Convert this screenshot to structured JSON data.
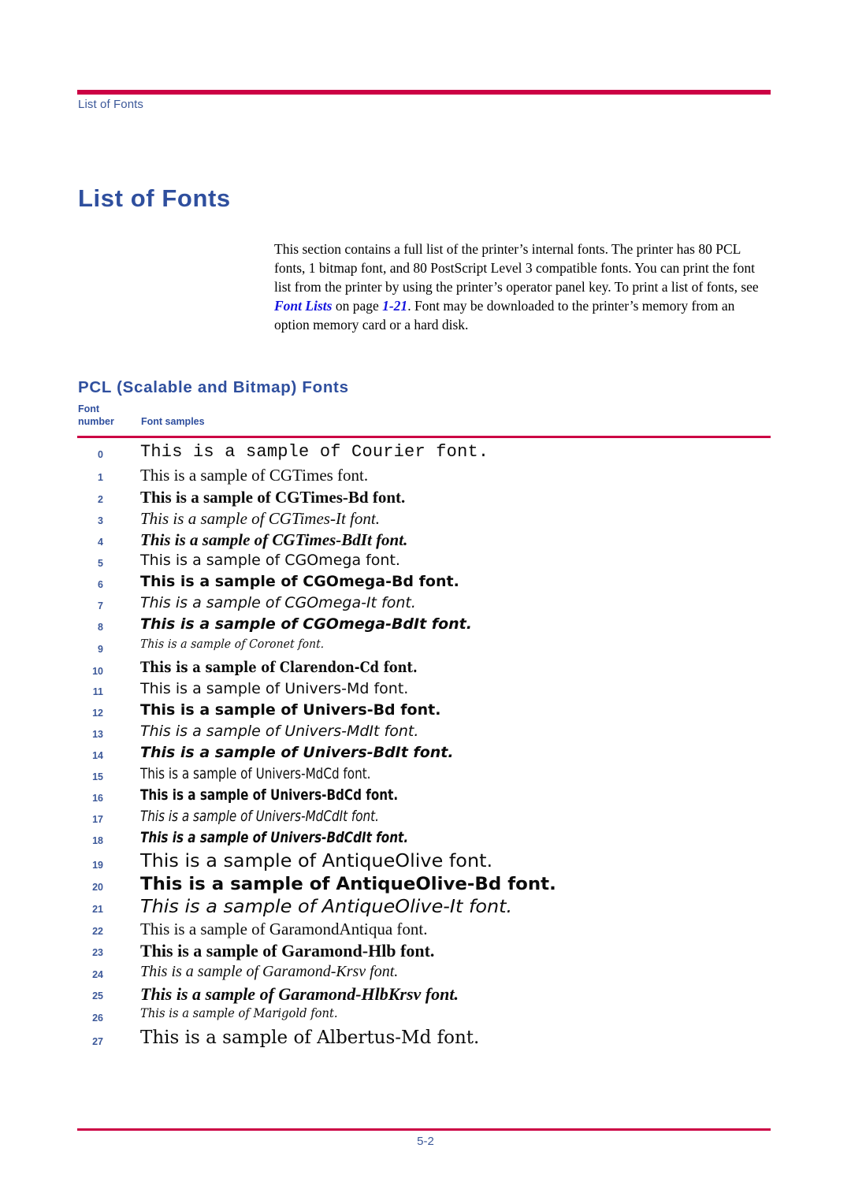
{
  "page": {
    "running_header": "List of Fonts",
    "chapter_title": "List of Fonts",
    "folio": "5-2",
    "rule_color": "#cc0044",
    "heading_color": "#2f4f9e",
    "link_color": "#1414dd"
  },
  "intro": {
    "part1": "This section contains a full list of the printer’s internal fonts. The printer has 80 PCL fonts, 1 bitmap font, and 80 PostScript Level 3 compatible fonts. You can print the font list from the printer by using the printer’s operator panel key. To print a list of fonts, see ",
    "xref_label": "Font Lists",
    "part2": " on page ",
    "xref_page": "1-21",
    "part3": ". Font may be downloaded to the printer’s memory from an option memory card or a hard disk."
  },
  "section": {
    "heading": "PCL (Scalable and Bitmap) Fonts"
  },
  "table": {
    "header": {
      "col_number_line1": "Font",
      "col_number_line2": "number",
      "col_samples": "Font samples"
    },
    "rows": [
      {
        "number": "0",
        "sample": "This is a sample of Courier font."
      },
      {
        "number": "1",
        "sample": "This is a sample of CGTimes font."
      },
      {
        "number": "2",
        "sample": "This is a sample of CGTimes-Bd font."
      },
      {
        "number": "3",
        "sample": "This is a sample of CGTimes-It font."
      },
      {
        "number": "4",
        "sample": "This is a sample of CGTimes-BdIt font."
      },
      {
        "number": "5",
        "sample": "This is a sample of CGOmega font."
      },
      {
        "number": "6",
        "sample": "This is a sample of CGOmega-Bd font."
      },
      {
        "number": "7",
        "sample": "This is a sample of CGOmega-It font."
      },
      {
        "number": "8",
        "sample": "This is a sample of CGOmega-BdIt font."
      },
      {
        "number": "9",
        "sample": "This is a sample of Coronet font."
      },
      {
        "number": "10",
        "sample": "This is a sample of Clarendon-Cd font."
      },
      {
        "number": "11",
        "sample": "This is a sample of Univers-Md font."
      },
      {
        "number": "12",
        "sample": "This is a sample of Univers-Bd font."
      },
      {
        "number": "13",
        "sample": "This is a sample of Univers-MdIt font."
      },
      {
        "number": "14",
        "sample": "This is a sample of Univers-BdIt font."
      },
      {
        "number": "15",
        "sample": "This is a sample of Univers-MdCd font."
      },
      {
        "number": "16",
        "sample": "This is a sample of Univers-BdCd font."
      },
      {
        "number": "17",
        "sample": "This is a sample of Univers-MdCdIt font."
      },
      {
        "number": "18",
        "sample": "This is a sample of Univers-BdCdIt font."
      },
      {
        "number": "19",
        "sample": "This is a sample of AntiqueOlive font."
      },
      {
        "number": "20",
        "sample": "This is a sample of AntiqueOlive-Bd font."
      },
      {
        "number": "21",
        "sample": "This is a sample of AntiqueOlive-It font."
      },
      {
        "number": "22",
        "sample": "This is a sample of GaramondAntiqua font."
      },
      {
        "number": "23",
        "sample": "This is a sample of Garamond-Hlb font."
      },
      {
        "number": "24",
        "sample": "This is a sample of Garamond-Krsv font."
      },
      {
        "number": "25",
        "sample": "This is a sample of Garamond-HlbKrsv font."
      },
      {
        "number": "26",
        "sample": "This is a sample of Marigold font."
      },
      {
        "number": "27",
        "sample": "This is a sample of Albertus-Md font."
      }
    ]
  }
}
